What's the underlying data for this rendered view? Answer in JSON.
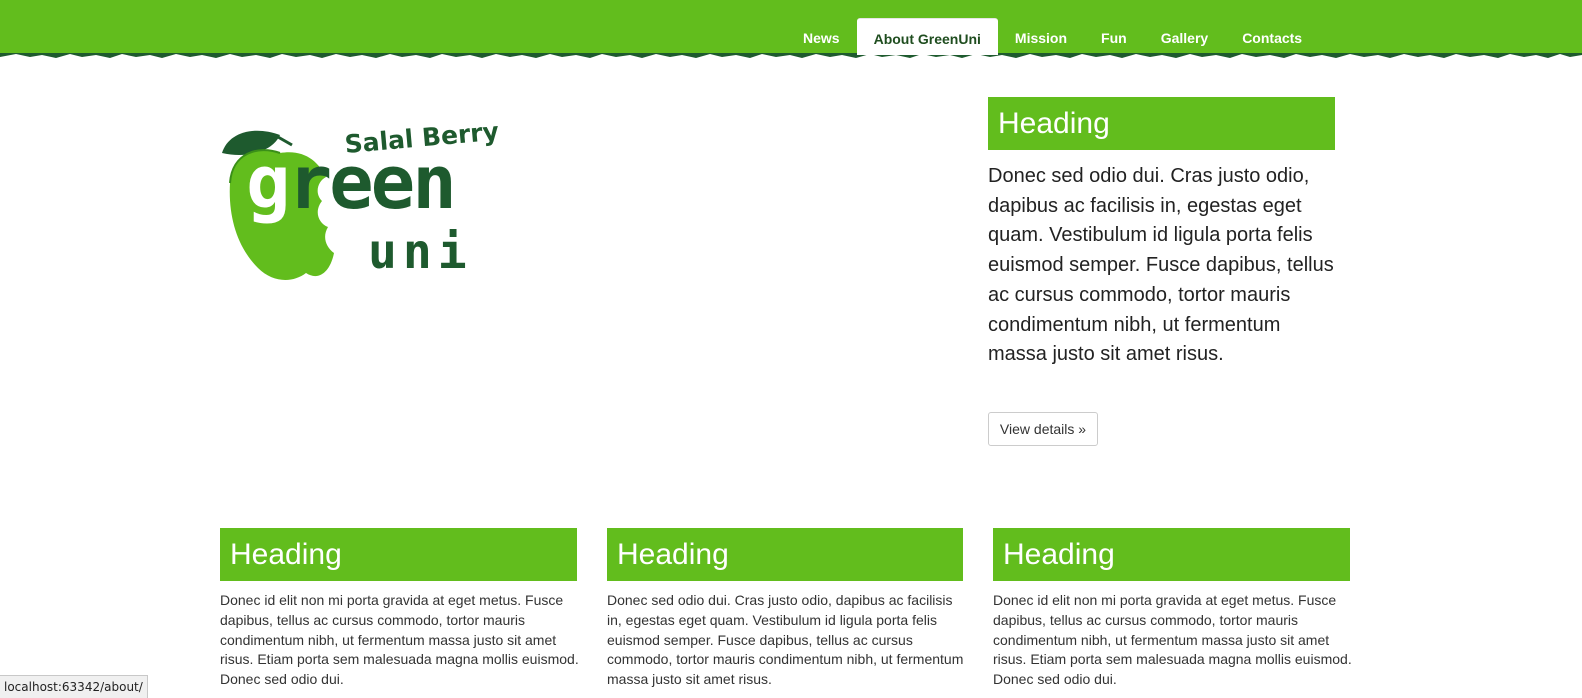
{
  "colors": {
    "brand_green": "#62bd1d",
    "dark_green": "#1e5a2e"
  },
  "nav": {
    "items": [
      {
        "label": "News"
      },
      {
        "label": "About GreenUni",
        "active": true
      },
      {
        "label": "Mission"
      },
      {
        "label": "Fun"
      },
      {
        "label": "Gallery"
      },
      {
        "label": "Contacts"
      }
    ]
  },
  "logo": {
    "tagline": "Salal Berry",
    "word1_first": "g",
    "word1_rest": "reen",
    "word2": "uni",
    "icon": "apple-icon"
  },
  "hero": {
    "heading": "Heading",
    "text": "Donec sed odio dui. Cras justo odio, dapibus ac facilisis in, egestas eget quam. Vestibulum id ligula porta felis euismod semper. Fusce dapibus, tellus ac cursus commodo, tortor mauris condimentum nibh, ut fermentum massa justo sit amet risus.",
    "button": "View details »"
  },
  "columns": [
    {
      "heading": "Heading",
      "text": "Donec id elit non mi porta gravida at eget metus. Fusce dapibus, tellus ac cursus commodo, tortor mauris condimentum nibh, ut fermentum massa justo sit amet risus. Etiam porta sem malesuada magna mollis euismod. Donec sed odio dui."
    },
    {
      "heading": "Heading",
      "text": "Donec sed odio dui. Cras justo odio, dapibus ac facilisis in, egestas eget quam. Vestibulum id ligula porta felis euismod semper. Fusce dapibus, tellus ac cursus commodo, tortor mauris condimentum nibh, ut fermentum massa justo sit amet risus."
    },
    {
      "heading": "Heading",
      "text": "Donec id elit non mi porta gravida at eget metus. Fusce dapibus, tellus ac cursus commodo, tortor mauris condimentum nibh, ut fermentum massa justo sit amet risus. Etiam porta sem malesuada magna mollis euismod. Donec sed odio dui."
    }
  ],
  "status_bar": {
    "url": "localhost:63342/about/"
  }
}
